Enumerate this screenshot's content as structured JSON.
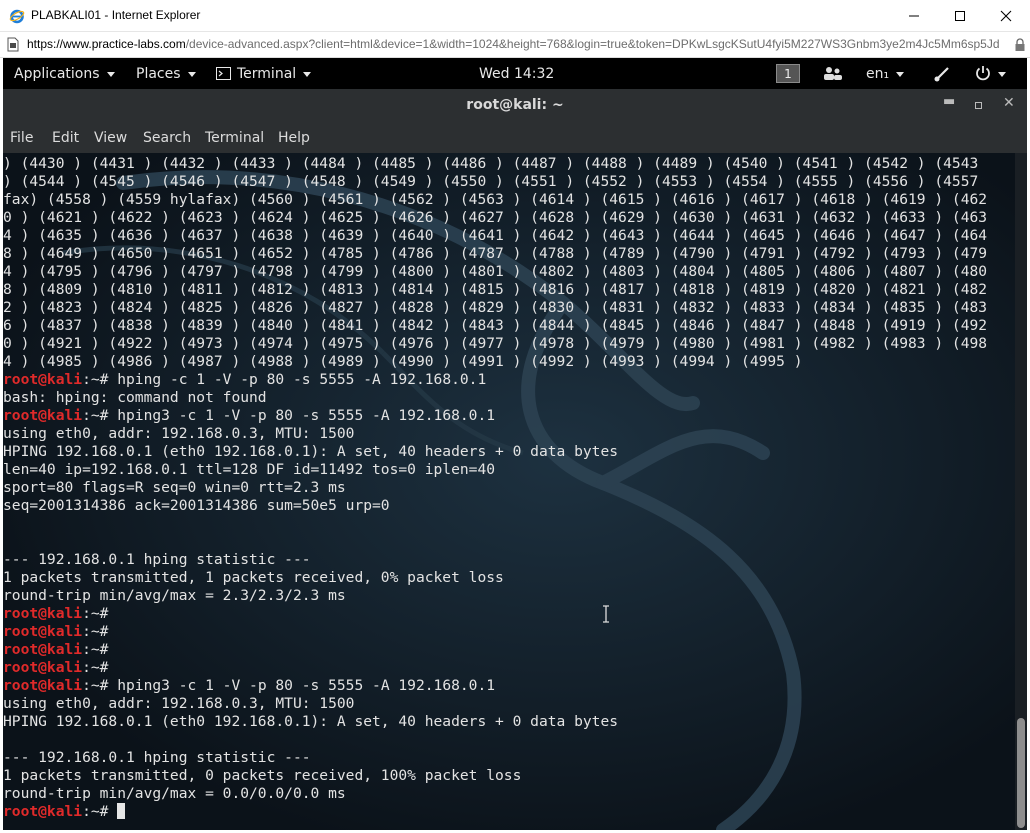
{
  "window": {
    "title": "PLABKALI01 - Internet Explorer",
    "minimize": "—",
    "maximize": "☐",
    "close": "✕"
  },
  "address_bar": {
    "url_host": "https://www.practice-labs.com",
    "url_rest": "/device-advanced.aspx?client=html&device=1&width=1024&height=768&login=true&token=DPKwLsgcKSutU4fyi5M227WS3Gnbm3ye2m4Jc5Mm6sp5Jd",
    "lock_icon": "lock-icon"
  },
  "gnome_topbar": {
    "applications": "Applications",
    "places": "Places",
    "terminal": "Terminal",
    "clock": "Wed 14:32",
    "workspace": "1",
    "keyboard": "en₁"
  },
  "terminal": {
    "title": "root@kali: ~",
    "menu": [
      "File",
      "Edit",
      "View",
      "Search",
      "Terminal",
      "Help"
    ],
    "lines": [
      {
        "t": ") (4430 ) (4431 ) (4432 ) (4433 ) (4484 ) (4485 ) (4486 ) (4487 ) (4488 ) (4489 ) (4540 ) (4541 ) (4542 ) (4543"
      },
      {
        "t": ") (4544 ) (4545 ) (4546 ) (4547 ) (4548 ) (4549 ) (4550 ) (4551 ) (4552 ) (4553 ) (4554 ) (4555 ) (4556 ) (4557"
      },
      {
        "t": "fax) (4558 ) (4559 hylafax) (4560 ) (4561 ) (4562 ) (4563 ) (4614 ) (4615 ) (4616 ) (4617 ) (4618 ) (4619 ) (462"
      },
      {
        "t": "0 ) (4621 ) (4622 ) (4623 ) (4624 ) (4625 ) (4626 ) (4627 ) (4628 ) (4629 ) (4630 ) (4631 ) (4632 ) (4633 ) (463"
      },
      {
        "t": "4 ) (4635 ) (4636 ) (4637 ) (4638 ) (4639 ) (4640 ) (4641 ) (4642 ) (4643 ) (4644 ) (4645 ) (4646 ) (4647 ) (464"
      },
      {
        "t": "8 ) (4649 ) (4650 ) (4651 ) (4652 ) (4785 ) (4786 ) (4787 ) (4788 ) (4789 ) (4790 ) (4791 ) (4792 ) (4793 ) (479"
      },
      {
        "t": "4 ) (4795 ) (4796 ) (4797 ) (4798 ) (4799 ) (4800 ) (4801 ) (4802 ) (4803 ) (4804 ) (4805 ) (4806 ) (4807 ) (480"
      },
      {
        "t": "8 ) (4809 ) (4810 ) (4811 ) (4812 ) (4813 ) (4814 ) (4815 ) (4816 ) (4817 ) (4818 ) (4819 ) (4820 ) (4821 ) (482"
      },
      {
        "t": "2 ) (4823 ) (4824 ) (4825 ) (4826 ) (4827 ) (4828 ) (4829 ) (4830 ) (4831 ) (4832 ) (4833 ) (4834 ) (4835 ) (483"
      },
      {
        "t": "6 ) (4837 ) (4838 ) (4839 ) (4840 ) (4841 ) (4842 ) (4843 ) (4844 ) (4845 ) (4846 ) (4847 ) (4848 ) (4919 ) (492"
      },
      {
        "t": "0 ) (4921 ) (4922 ) (4973 ) (4974 ) (4975 ) (4976 ) (4977 ) (4978 ) (4979 ) (4980 ) (4981 ) (4982 ) (4983 ) (498"
      },
      {
        "t": "4 ) (4985 ) (4986 ) (4987 ) (4988 ) (4989 ) (4990 ) (4991 ) (4992 ) (4993 ) (4994 ) (4995 )"
      },
      {
        "p": "root@kali",
        "d": ":~# ",
        "t": "hping -c 1 -V -p 80 -s 5555 -A 192.168.0.1"
      },
      {
        "t": "bash: hping: command not found"
      },
      {
        "p": "root@kali",
        "d": ":~# ",
        "t": "hping3 -c 1 -V -p 80 -s 5555 -A 192.168.0.1"
      },
      {
        "t": "using eth0, addr: 192.168.0.3, MTU: 1500"
      },
      {
        "t": "HPING 192.168.0.1 (eth0 192.168.0.1): A set, 40 headers + 0 data bytes"
      },
      {
        "t": "len=40 ip=192.168.0.1 ttl=128 DF id=11492 tos=0 iplen=40"
      },
      {
        "t": "sport=80 flags=R seq=0 win=0 rtt=2.3 ms"
      },
      {
        "t": "seq=2001314386 ack=2001314386 sum=50e5 urp=0"
      },
      {
        "t": ""
      },
      {
        "t": ""
      },
      {
        "t": "--- 192.168.0.1 hping statistic ---"
      },
      {
        "t": "1 packets transmitted, 1 packets received, 0% packet loss"
      },
      {
        "t": "round-trip min/avg/max = 2.3/2.3/2.3 ms"
      },
      {
        "p": "root@kali",
        "d": ":~# ",
        "t": ""
      },
      {
        "p": "root@kali",
        "d": ":~# ",
        "t": ""
      },
      {
        "p": "root@kali",
        "d": ":~# ",
        "t": ""
      },
      {
        "p": "root@kali",
        "d": ":~# ",
        "t": ""
      },
      {
        "p": "root@kali",
        "d": ":~# ",
        "t": "hping3 -c 1 -V -p 80 -s 5555 -A 192.168.0.1"
      },
      {
        "t": "using eth0, addr: 192.168.0.3, MTU: 1500"
      },
      {
        "t": "HPING 192.168.0.1 (eth0 192.168.0.1): A set, 40 headers + 0 data bytes"
      },
      {
        "t": ""
      },
      {
        "t": "--- 192.168.0.1 hping statistic ---"
      },
      {
        "t": "1 packets transmitted, 0 packets received, 100% packet loss"
      },
      {
        "t": "round-trip min/avg/max = 0.0/0.0/0.0 ms"
      },
      {
        "p": "root@kali",
        "d": ":~# ",
        "t": "",
        "cursor": true
      }
    ]
  },
  "colors": {
    "prompt_user": "#e02a2a",
    "terminal_bg": "#0d1720",
    "terminal_fg": "#e3e3e3",
    "chrome_bg": "#2c2f31"
  }
}
